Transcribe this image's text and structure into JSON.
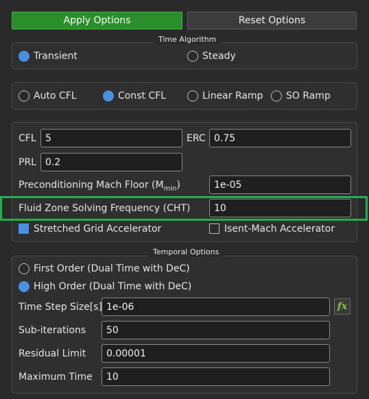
{
  "buttons": {
    "apply": "Apply Options",
    "reset": "Reset Options"
  },
  "time_algorithm": {
    "title": "Time Algorithm",
    "options": [
      {
        "label": "Transient",
        "selected": true
      },
      {
        "label": "Steady",
        "selected": false
      }
    ]
  },
  "cfl_mode": {
    "options": [
      {
        "label": "Auto CFL",
        "selected": false
      },
      {
        "label": "Const CFL",
        "selected": true
      },
      {
        "label": "Linear Ramp",
        "selected": false
      },
      {
        "label": "SO Ramp",
        "selected": false
      }
    ]
  },
  "solver": {
    "cfl_label": "CFL",
    "cfl_value": "5",
    "erc_label": "ERC",
    "erc_value": "0.75",
    "prl_label": "PRL",
    "prl_value": "0.2",
    "mach_floor_label": "Preconditioning Mach Floor (M",
    "mach_floor_sub": "min",
    "mach_floor_close": ")",
    "mach_floor_value": "1e-05",
    "cht_label": "Fluid Zone Solving Frequency (CHT)",
    "cht_value": "10",
    "stretched_label": "Stretched Grid Accelerator",
    "stretched_checked": true,
    "isent_label": "Isent-Mach Accelerator",
    "isent_checked": false
  },
  "temporal": {
    "title": "Temporal Options",
    "order_options": [
      {
        "label": "First Order (Dual Time with DeC)",
        "selected": false
      },
      {
        "label": "High Order (Dual Time with DeC)",
        "selected": true
      }
    ],
    "time_step_label": "Time Step Size[s]",
    "time_step_value": "1e-06",
    "fx_label": "fx",
    "subiter_label": "Sub-iterations",
    "subiter_value": "50",
    "residual_label": "Residual Limit",
    "residual_value": "0.00001",
    "max_time_label": "Maximum Time",
    "max_time_value": "10"
  },
  "colors": {
    "accent_green": "#2a8f2a",
    "radio_blue": "#4a90e2",
    "highlight": "#22b14c"
  }
}
